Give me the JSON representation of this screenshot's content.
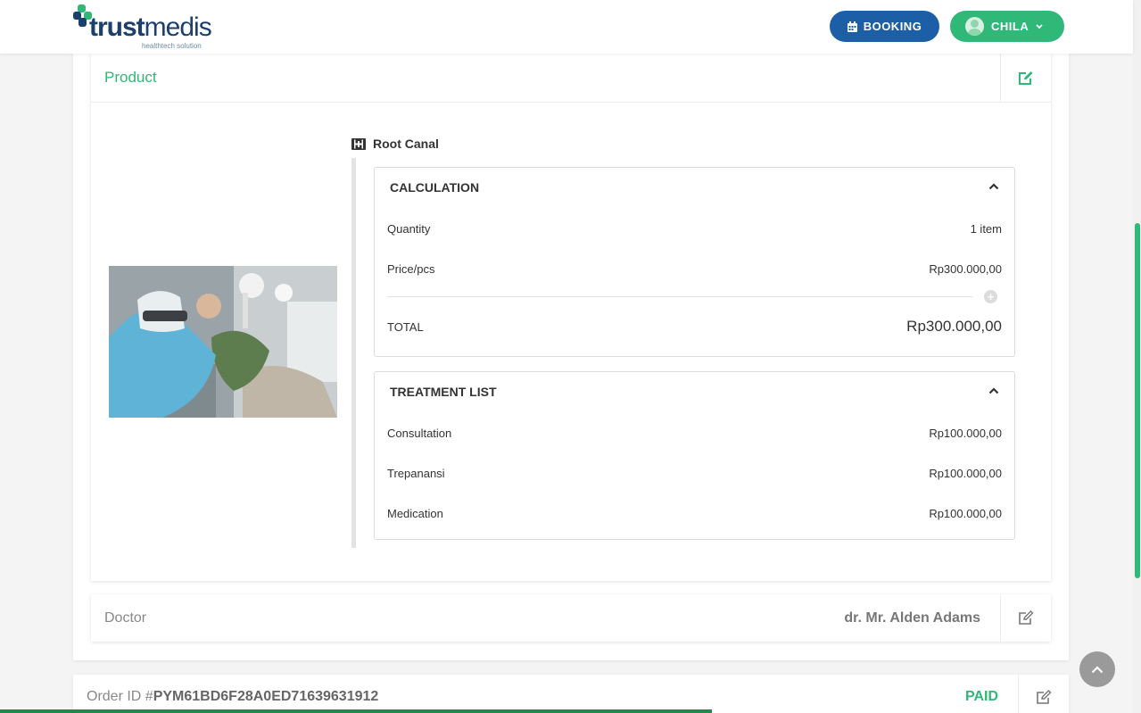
{
  "header": {
    "logo_text_bold": "trust",
    "logo_text_light": "medis",
    "logo_tagline": "healthtech solution",
    "booking_label": "BOOKING",
    "user_label": "CHILA"
  },
  "product": {
    "section_title": "Product",
    "item_name": "Root Canal",
    "calculation": {
      "title": "CALCULATION",
      "quantity_label": "Quantity",
      "quantity_value": "1 item",
      "price_label": "Price/pcs",
      "price_value": "Rp300.000,00",
      "total_label": "TOTAL",
      "total_value": "Rp300.000,00"
    },
    "treatment_list": {
      "title": "TREATMENT LIST",
      "items": [
        {
          "name": "Consultation",
          "price": "Rp100.000,00"
        },
        {
          "name": "Trepanansi",
          "price": "Rp100.000,00"
        },
        {
          "name": "Medication",
          "price": "Rp100.000,00"
        }
      ]
    }
  },
  "doctor": {
    "label": "Doctor",
    "value": "dr. Mr. Alden Adams"
  },
  "order": {
    "label_prefix": "Order ID #",
    "order_id": "PYM61BD6F28A0ED71639631912",
    "status": "PAID"
  },
  "colors": {
    "brand_green": "#2fb878",
    "brand_blue": "#1d5fa6",
    "progress_green": "#1f8a4c"
  },
  "progress_fraction": 0.624
}
